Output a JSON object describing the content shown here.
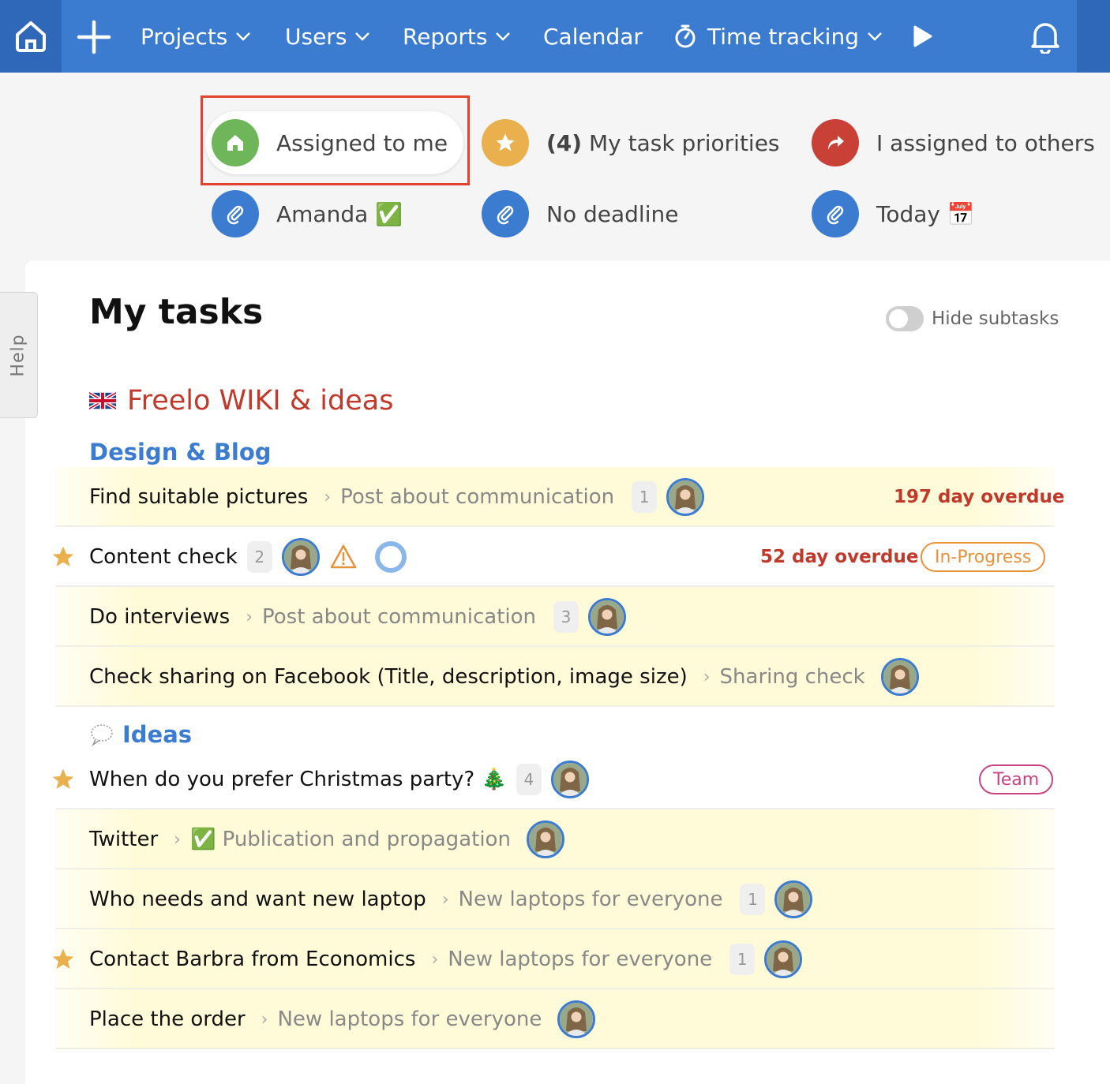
{
  "nav": {
    "items": [
      {
        "label": "Projects",
        "has_chevron": true
      },
      {
        "label": "Users",
        "has_chevron": true
      },
      {
        "label": "Reports",
        "has_chevron": true
      },
      {
        "label": "Calendar",
        "has_chevron": false
      },
      {
        "label": "Time tracking",
        "has_chevron": true
      }
    ],
    "icons": [
      "home-icon",
      "plus-icon",
      "stopwatch-icon",
      "play-icon",
      "bell-icon"
    ]
  },
  "filters": [
    {
      "label": "Assigned to me",
      "icon": "home-icon",
      "color": "#6fb65a",
      "active": true
    },
    {
      "prefix": "(4)",
      "label": "My task priorities",
      "icon": "star-icon",
      "color": "#eab04d"
    },
    {
      "label": "I assigned to others",
      "icon": "share-arrow-icon",
      "color": "#c94037"
    },
    {
      "label": "Amanda ✅",
      "icon": "paperclip-icon",
      "color": "#3b7bd0"
    },
    {
      "label": "No deadline",
      "icon": "paperclip-icon",
      "color": "#3b7bd0"
    },
    {
      "label": "Today 📅",
      "icon": "paperclip-icon",
      "color": "#3b7bd0"
    }
  ],
  "help": {
    "label": "Help"
  },
  "page": {
    "title": "My tasks",
    "hide_subtasks_label": "Hide subtasks",
    "hide_subtasks_on": false
  },
  "project": {
    "name": "Freelo WIKI & ideas",
    "flag": "uk-flag-icon",
    "color": "#c0392b"
  },
  "lists": [
    {
      "name": "Design & Blog",
      "tasks": [
        {
          "name": "Find suitable pictures",
          "crumb": "Post about communication",
          "count": "1",
          "overdue": "197 day overdue"
        },
        {
          "name": "Content check",
          "starred": true,
          "count": "2",
          "overdue": "52 day overdue",
          "badge": "In-Progress"
        },
        {
          "name": "Do interviews",
          "crumb": "Post about communication",
          "count": "3"
        },
        {
          "name": "Check sharing on Facebook (Title, description, image size)",
          "crumb": "Sharing check"
        }
      ]
    },
    {
      "name": "Ideas",
      "icon": "speech-bubble-icon",
      "tasks": [
        {
          "name": "When do you prefer Christmas party? 🎄",
          "starred": true,
          "count": "4",
          "badge": "Team"
        },
        {
          "name": "Twitter",
          "crumb": "✅ Publication and propagation"
        },
        {
          "name": "Who needs and want new laptop",
          "crumb": "New laptops for everyone",
          "count": "1"
        },
        {
          "name": "Contact Barbra from Economics",
          "starred": true,
          "crumb": "New laptops for everyone",
          "count": "1"
        },
        {
          "name": "Place the order",
          "crumb": "New laptops for everyone"
        }
      ]
    }
  ],
  "colors": {
    "nav": "#3b7bd0",
    "nav_dark": "#2f68b8",
    "link_blue": "#3b7bd0",
    "overdue_red": "#c0392b",
    "progress_orange": "#e8923a",
    "team_pink": "#c8437f"
  }
}
